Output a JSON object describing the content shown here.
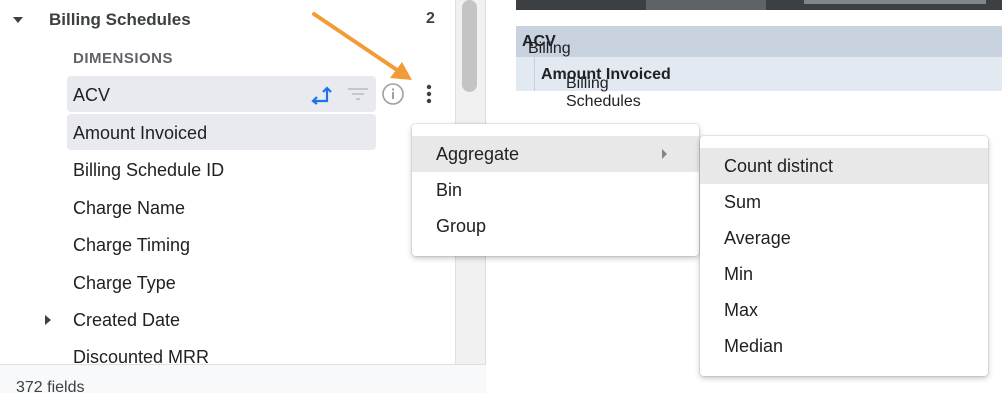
{
  "picker": {
    "group_title": "Billing Schedules",
    "group_count": "2",
    "section_label": "DIMENSIONS",
    "fields": [
      {
        "label": "ACV"
      },
      {
        "label": "Amount Invoiced"
      },
      {
        "label": "Billing Schedule ID"
      },
      {
        "label": "Charge Name"
      },
      {
        "label": "Charge Timing"
      },
      {
        "label": "Charge Type"
      },
      {
        "label": "Created Date"
      },
      {
        "label": "Discounted MRR"
      }
    ],
    "footer_text": "372 fields"
  },
  "results": {
    "column1_prefix": "Billing Schedules",
    "column1_field": "ACV",
    "column2_prefix": "Billing Schedules",
    "column2_field": "Amount Invoiced"
  },
  "context_menu": {
    "items": [
      {
        "label": "Aggregate"
      },
      {
        "label": "Bin"
      },
      {
        "label": "Group"
      }
    ]
  },
  "aggregate_submenu": {
    "items": [
      {
        "label": "Count distinct"
      },
      {
        "label": "Sum"
      },
      {
        "label": "Average"
      },
      {
        "label": "Min"
      },
      {
        "label": "Max"
      },
      {
        "label": "Median"
      }
    ]
  },
  "colors": {
    "arrow": "#f29c38",
    "pivot_icon": "#1a73e8",
    "header_blue": "#c9d3e0"
  }
}
